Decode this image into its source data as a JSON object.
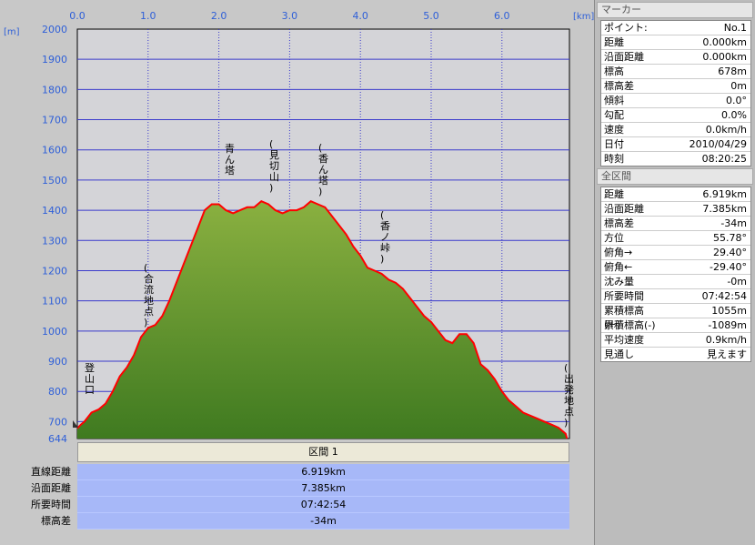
{
  "chart_data": {
    "type": "area",
    "x_unit": "[km]",
    "y_unit": "[m]",
    "x_ticks": [
      "0.0",
      "1.0",
      "2.0",
      "3.0",
      "4.0",
      "5.0",
      "6.0"
    ],
    "y_ticks": [
      "2000",
      "1900",
      "1800",
      "1700",
      "1600",
      "1500",
      "1400",
      "1300",
      "1200",
      "1100",
      "1000",
      "900",
      "800",
      "700",
      "644"
    ],
    "xlim": [
      0,
      6.919
    ],
    "ylim": [
      644,
      2000
    ],
    "x": [
      0,
      0.05,
      0.1,
      0.15,
      0.2,
      0.3,
      0.4,
      0.5,
      0.6,
      0.7,
      0.8,
      0.9,
      1.0,
      1.1,
      1.2,
      1.3,
      1.4,
      1.5,
      1.6,
      1.7,
      1.8,
      1.9,
      2.0,
      2.1,
      2.2,
      2.3,
      2.4,
      2.5,
      2.6,
      2.7,
      2.8,
      2.9,
      3.0,
      3.1,
      3.2,
      3.3,
      3.4,
      3.5,
      3.6,
      3.7,
      3.8,
      3.9,
      4.0,
      4.1,
      4.2,
      4.3,
      4.4,
      4.5,
      4.6,
      4.7,
      4.8,
      4.9,
      5.0,
      5.1,
      5.2,
      5.3,
      5.4,
      5.5,
      5.6,
      5.7,
      5.8,
      5.9,
      6.0,
      6.1,
      6.2,
      6.3,
      6.4,
      6.5,
      6.6,
      6.7,
      6.8,
      6.9,
      6.919
    ],
    "y": [
      678,
      690,
      700,
      715,
      730,
      740,
      760,
      800,
      850,
      880,
      920,
      980,
      1010,
      1020,
      1050,
      1100,
      1160,
      1220,
      1280,
      1340,
      1400,
      1420,
      1420,
      1400,
      1390,
      1400,
      1410,
      1410,
      1430,
      1420,
      1400,
      1390,
      1400,
      1400,
      1410,
      1430,
      1420,
      1410,
      1380,
      1350,
      1320,
      1280,
      1250,
      1210,
      1200,
      1190,
      1170,
      1160,
      1140,
      1110,
      1080,
      1050,
      1030,
      1000,
      970,
      960,
      990,
      990,
      960,
      890,
      870,
      840,
      800,
      770,
      750,
      730,
      720,
      710,
      700,
      690,
      680,
      660,
      644
    ],
    "annotations": [
      "登山口",
      "(合流地点)",
      "青ん塔",
      "(見切山)",
      "(香ん塔)",
      "(香ノ峠)",
      "(出発地点)"
    ]
  },
  "section": {
    "header": "区間 1",
    "labels": [
      "直線距離",
      "沿面距離",
      "所要時間",
      "標高差"
    ],
    "values": [
      "6.919km",
      "7.385km",
      "07:42:54",
      "-34m"
    ]
  },
  "marker": {
    "title": "マーカー",
    "rows": [
      {
        "k": "ポイント:",
        "v": "No.1"
      },
      {
        "k": "距離",
        "v": "0.000km"
      },
      {
        "k": "沿面距離",
        "v": "0.000km"
      },
      {
        "k": "標高",
        "v": "678m"
      },
      {
        "k": "標高差",
        "v": "0m"
      },
      {
        "k": "傾斜",
        "v": "0.0°"
      },
      {
        "k": "勾配",
        "v": "0.0%"
      },
      {
        "k": "速度",
        "v": "0.0km/h"
      },
      {
        "k": "日付",
        "v": "2010/04/29"
      },
      {
        "k": "時刻",
        "v": "08:20:25"
      }
    ]
  },
  "total": {
    "title": "全区間",
    "rows": [
      {
        "k": "距離",
        "v": "6.919km"
      },
      {
        "k": "沿面距離",
        "v": "7.385km"
      },
      {
        "k": "標高差",
        "v": "-34m"
      },
      {
        "k": "方位",
        "v": "55.78°"
      },
      {
        "k": "俯角→",
        "v": "29.40°"
      },
      {
        "k": "俯角←",
        "v": "-29.40°"
      },
      {
        "k": "沈み量",
        "v": "-0m"
      },
      {
        "k": "所要時間",
        "v": "07:42:54"
      },
      {
        "k": "累積標高(+)",
        "v": "1055m"
      },
      {
        "k": "累積標高(-)",
        "v": "-1089m"
      },
      {
        "k": "平均速度",
        "v": "0.9km/h"
      },
      {
        "k": "見通し",
        "v": "見えます"
      }
    ]
  },
  "colors": {
    "plot_bg": "#d4d4d8",
    "grid": "#3a3acc",
    "line": "#ff0000",
    "fill_top": "#8ab040",
    "fill_bottom": "#3f7a20",
    "axis_text": "#2e5fd8",
    "stats_bg": "#a7b8f8"
  }
}
